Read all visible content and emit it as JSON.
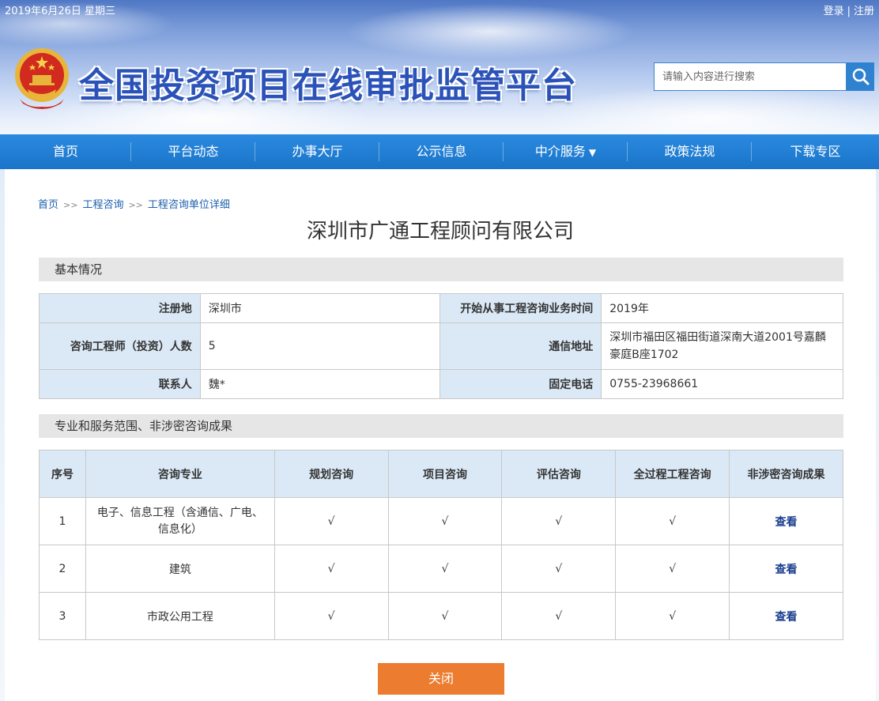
{
  "topbar": {
    "date": "2019年6月26日 星期三",
    "login": "登录",
    "separator": "|",
    "register": "注册"
  },
  "header": {
    "site_title": "全国投资项目在线审批监管平台",
    "search_placeholder": "请输入内容进行搜索"
  },
  "nav": {
    "items": [
      "首页",
      "平台动态",
      "办事大厅",
      "公示信息",
      "中介服务",
      "政策法规",
      "下载专区"
    ],
    "caret": "▼"
  },
  "breadcrumb": {
    "home": "首页",
    "level2": "工程咨询",
    "level3": "工程咨询单位详细",
    "arrow": ">>"
  },
  "company": {
    "name": "深圳市广通工程顾问有限公司"
  },
  "basic_info": {
    "section_title": "基本情况",
    "rows": [
      {
        "l1": "注册地",
        "v1": "深圳市",
        "l2": "开始从事工程咨询业务时间",
        "v2": "2019年"
      },
      {
        "l1": "咨询工程师（投资）人数",
        "v1": "5",
        "l2": "通信地址",
        "v2": "深圳市福田区福田街道深南大道2001号嘉麟豪庭B座1702"
      },
      {
        "l1": "联系人",
        "v1": "魏*",
        "l2": "固定电话",
        "v2": "0755-23968661"
      }
    ]
  },
  "services": {
    "section_title": "专业和服务范围、非涉密咨询成果",
    "headers": [
      "序号",
      "咨询专业",
      "规划咨询",
      "项目咨询",
      "评估咨询",
      "全过程工程咨询",
      "非涉密咨询成果"
    ],
    "rows": [
      {
        "no": "1",
        "specialty": "电子、信息工程（含通信、广电、信息化）",
        "c1": "√",
        "c2": "√",
        "c3": "√",
        "c4": "√",
        "link": "查看"
      },
      {
        "no": "2",
        "specialty": "建筑",
        "c1": "√",
        "c2": "√",
        "c3": "√",
        "c4": "√",
        "link": "查看"
      },
      {
        "no": "3",
        "specialty": "市政公用工程",
        "c1": "√",
        "c2": "√",
        "c3": "√",
        "c4": "√",
        "link": "查看"
      }
    ]
  },
  "footer": {
    "close_label": "关闭"
  },
  "colors": {
    "nav_blue": "#1f7fd6",
    "header_cell": "#dbe9f6",
    "close_button": "#ec7c30",
    "title_blue": "#2a52b8"
  }
}
